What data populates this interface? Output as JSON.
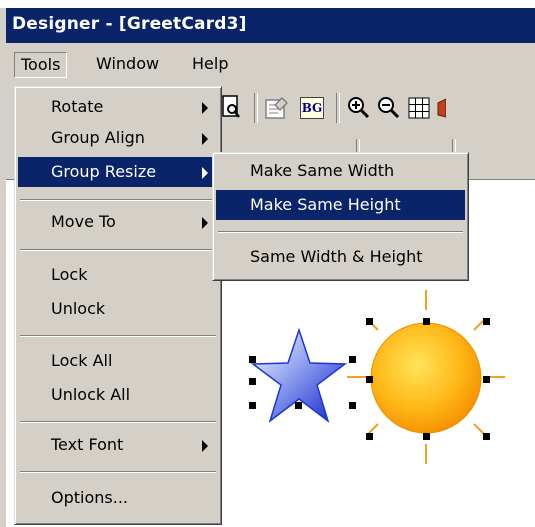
{
  "window": {
    "title": "Designer  - [GreetCard3]"
  },
  "menubar": {
    "items": [
      "Tools",
      "Window",
      "Help"
    ]
  },
  "tools_menu": {
    "items": [
      {
        "label": "Rotate",
        "submenu": true
      },
      {
        "label": "Group Align",
        "submenu": true
      },
      {
        "label": "Group Resize",
        "submenu": true,
        "highlighted": true
      },
      {
        "label": "Move To",
        "submenu": true
      },
      {
        "label": "Lock",
        "submenu": false
      },
      {
        "label": "Unlock",
        "submenu": false
      },
      {
        "label": "Lock All",
        "submenu": false
      },
      {
        "label": "Unlock All",
        "submenu": false
      },
      {
        "label": "Text Font",
        "submenu": true
      },
      {
        "label": "Options...",
        "submenu": false
      }
    ]
  },
  "group_resize_submenu": {
    "items": [
      {
        "label": "Make Same Width",
        "highlighted": false
      },
      {
        "label": "Make Same Height",
        "highlighted": true
      },
      {
        "label": "Same Width & Height",
        "highlighted": false
      }
    ]
  },
  "toolbar": {
    "icons": [
      "print-preview-icon",
      "properties-icon",
      "background-icon",
      "zoom-in-icon",
      "zoom-out-icon",
      "grid-icon"
    ],
    "bg_label": "BG"
  },
  "canvas": {
    "objects": [
      "star-shape",
      "sun-shape"
    ]
  },
  "colors": {
    "highlight": "#0a246a",
    "face": "#d4d0c8",
    "sun": "#ffb400",
    "star": "#1c35d8"
  }
}
